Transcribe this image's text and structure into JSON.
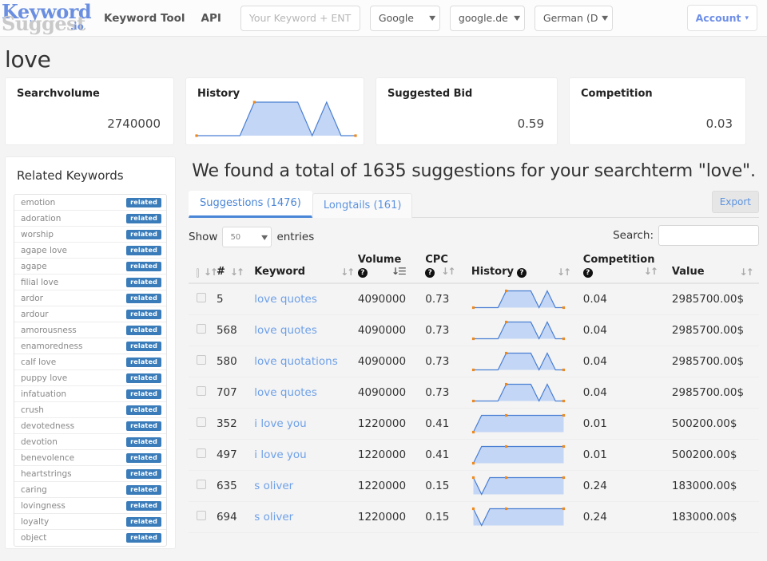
{
  "navbar": {
    "logo": {
      "part1": "Keyword",
      "part2": "Suggest",
      "part3": ".io"
    },
    "links": [
      {
        "name": "keyword-tool",
        "label": "Keyword Tool"
      },
      {
        "name": "api",
        "label": "API"
      }
    ],
    "keyword_input": {
      "value": "",
      "placeholder": "Your Keyword + ENTER"
    },
    "engine_select": {
      "value": "Google"
    },
    "domain_select": {
      "value": "google.de (G"
    },
    "language_select": {
      "value": "German (Deu"
    },
    "account_button": {
      "label": "Account",
      "caret": "▾"
    }
  },
  "page_title": "love",
  "cards": [
    {
      "name": "searchvolume",
      "title": "Searchvolume",
      "value": "2740000"
    },
    {
      "name": "history",
      "title": "History",
      "value": ""
    },
    {
      "name": "suggested-bid",
      "title": "Suggested Bid",
      "value": "0.59"
    },
    {
      "name": "competition",
      "title": "Competition",
      "value": "0.03"
    }
  ],
  "chart_data": {
    "type": "line",
    "title": "History",
    "xlabel": "",
    "ylabel": "",
    "grid": false,
    "legend": "none",
    "ylim": [
      0,
      1
    ],
    "x": [
      0,
      1,
      2,
      3,
      4,
      5,
      6,
      7,
      8,
      9,
      10,
      11
    ],
    "values": [
      0,
      0,
      0,
      0,
      1,
      1,
      1,
      1,
      0,
      1,
      0,
      0
    ],
    "series": [
      {
        "name": "main-history",
        "values": [
          0,
          0,
          0,
          0,
          1,
          1,
          1,
          1,
          0,
          1,
          0,
          0
        ]
      }
    ],
    "point_color": "#f0881a",
    "line_color": "#4a7fd4",
    "fill_color": "#c3d6f5"
  },
  "sidebar": {
    "title": "Related Keywords",
    "badge_label": "related",
    "items": [
      {
        "label": "emotion"
      },
      {
        "label": "adoration"
      },
      {
        "label": "worship"
      },
      {
        "label": "agape love"
      },
      {
        "label": "agape"
      },
      {
        "label": "filial love"
      },
      {
        "label": "ardor"
      },
      {
        "label": "ardour"
      },
      {
        "label": "amorousness"
      },
      {
        "label": "enamoredness"
      },
      {
        "label": "calf love"
      },
      {
        "label": "puppy love"
      },
      {
        "label": "infatuation"
      },
      {
        "label": "crush"
      },
      {
        "label": "devotedness"
      },
      {
        "label": "devotion"
      },
      {
        "label": "benevolence"
      },
      {
        "label": "heartstrings"
      },
      {
        "label": "caring"
      },
      {
        "label": "lovingness"
      },
      {
        "label": "loyalty"
      },
      {
        "label": "object"
      }
    ]
  },
  "main": {
    "found_heading": "We found a total of 1635 suggestions for your searchterm \"love\".",
    "tabs": [
      {
        "name": "suggestions",
        "label": "Suggestions (1476)",
        "active": true
      },
      {
        "name": "longtails",
        "label": "Longtails (161)",
        "active": false
      }
    ],
    "export_label": "Export",
    "show_label": "Show",
    "entries_label": "entries",
    "page_length": "50",
    "search_label": "Search:",
    "search_value": "",
    "search_placeholder": "",
    "table": {
      "headers": {
        "num": "#",
        "keyword": "Keyword",
        "volume": "Volume",
        "cpc": "CPC",
        "history": "History",
        "competition": "Competition",
        "value": "Value"
      },
      "sort_glyph": "↓↑",
      "sort_glyph_active": "↓☰",
      "help_glyph": "?",
      "rows": [
        {
          "num": "5",
          "keyword": "love quotes",
          "volume": "4090000",
          "cpc": "0.73",
          "competition": "0.04",
          "value": "2985700.00$",
          "history": [
            0,
            0,
            0,
            0,
            1,
            1,
            1,
            1,
            0,
            1,
            0,
            0
          ]
        },
        {
          "num": "568",
          "keyword": "love quotes",
          "volume": "4090000",
          "cpc": "0.73",
          "competition": "0.04",
          "value": "2985700.00$",
          "history": [
            0,
            0,
            0,
            0,
            1,
            1,
            1,
            1,
            0,
            1,
            0,
            0
          ]
        },
        {
          "num": "580",
          "keyword": "love quotations",
          "volume": "4090000",
          "cpc": "0.73",
          "competition": "0.04",
          "value": "2985700.00$",
          "history": [
            0,
            0,
            0,
            0,
            1,
            1,
            1,
            1,
            0,
            1,
            0,
            0
          ]
        },
        {
          "num": "707",
          "keyword": "love quotes",
          "volume": "4090000",
          "cpc": "0.73",
          "competition": "0.04",
          "value": "2985700.00$",
          "history": [
            0,
            0,
            0,
            0,
            1,
            1,
            1,
            1,
            0,
            1,
            0,
            0
          ]
        },
        {
          "num": "352",
          "keyword": "i love you",
          "volume": "1220000",
          "cpc": "0.41",
          "competition": "0.01",
          "value": "500200.00$",
          "history": [
            0,
            1,
            1,
            1,
            1,
            1,
            1,
            1,
            1,
            1,
            1,
            1
          ]
        },
        {
          "num": "497",
          "keyword": "i love you",
          "volume": "1220000",
          "cpc": "0.41",
          "competition": "0.01",
          "value": "500200.00$",
          "history": [
            0,
            1,
            1,
            1,
            1,
            1,
            1,
            1,
            1,
            1,
            1,
            1
          ]
        },
        {
          "num": "635",
          "keyword": "s oliver",
          "volume": "1220000",
          "cpc": "0.15",
          "competition": "0.24",
          "value": "183000.00$",
          "history": [
            1,
            0,
            1,
            1,
            1,
            1,
            1,
            1,
            1,
            1,
            1,
            1
          ]
        },
        {
          "num": "694",
          "keyword": "s oliver",
          "volume": "1220000",
          "cpc": "0.15",
          "competition": "0.24",
          "value": "183000.00$",
          "history": [
            1,
            0,
            1,
            1,
            1,
            1,
            1,
            1,
            1,
            1,
            1,
            1
          ]
        }
      ]
    }
  },
  "colors": {
    "brand_blue": "#6b8fe0",
    "link_blue": "#6ea0e8",
    "badge_blue": "#3a7cba",
    "spark_line": "#4a7fd4",
    "spark_fill": "#c3d6f5",
    "spark_point": "#f0881a",
    "page_bg": "#f4f4f4"
  }
}
